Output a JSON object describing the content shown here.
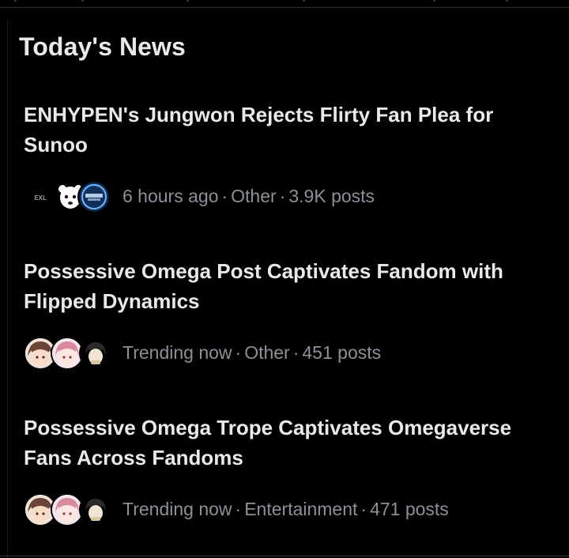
{
  "section": {
    "title": "Today's News"
  },
  "news": [
    {
      "headline": "ENHYPEN's Jungwon Rejects Flirty Fan Plea for Sunoo",
      "time": "6 hours ago",
      "category": "Other",
      "posts": "3.9K posts",
      "avatars": [
        "text-logo-avatar",
        "white-mascot-avatar",
        "blue-logo-avatar"
      ],
      "logo_text": "EXL"
    },
    {
      "headline": "Possessive Omega Post Captivates Fandom with Flipped Dynamics",
      "time": "Trending now",
      "category": "Other",
      "posts": "451 posts",
      "avatars": [
        "anime-brown-hair-avatar",
        "anime-pink-hair-avatar",
        "anime-dark-hair-avatar"
      ]
    },
    {
      "headline": "Possessive Omega Trope Captivates Omegaverse Fans Across Fandoms",
      "time": "Trending now",
      "category": "Entertainment",
      "posts": "471 posts",
      "avatars": [
        "anime-brown-hair-avatar",
        "anime-pink-hair-avatar",
        "anime-dark-hair-avatar"
      ]
    }
  ],
  "separator": "·",
  "colors": {
    "background": "#000000",
    "text": "#e7e9ea",
    "muted": "#8b9196",
    "divider": "#2f3336"
  }
}
